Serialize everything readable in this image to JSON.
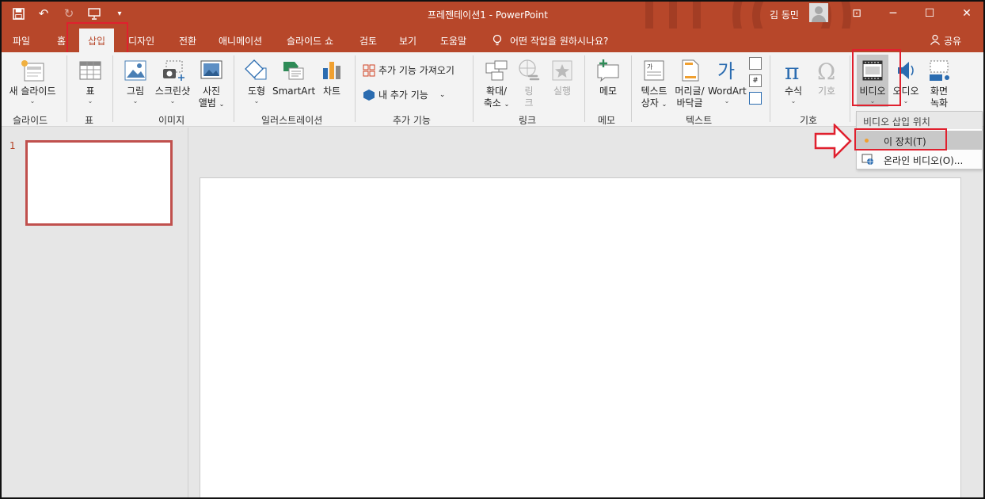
{
  "window": {
    "title": "프레젠테이션1  -  PowerPoint",
    "user": "김 동민",
    "qat": [
      "save-icon",
      "undo-icon",
      "redo-icon",
      "slideshow-icon",
      "customize-icon"
    ]
  },
  "tabs": [
    "파일",
    "홈",
    "삽입",
    "디자인",
    "전환",
    "애니메이션",
    "슬라이드 쇼",
    "검토",
    "보기",
    "도움말"
  ],
  "tell_me": "어떤 작업을 원하시나요?",
  "share": "공유",
  "ribbon": {
    "new_slide": "새 슬라이드",
    "table": "표",
    "picture": "그림",
    "screenshot": "스크린샷",
    "photo_album_1": "사진",
    "photo_album_2": "앨범",
    "shapes": "도형",
    "smartart": "SmartArt",
    "chart": "차트",
    "get_addins": "추가 기능 가져오기",
    "my_addins": "내 추가 기능",
    "zoom_1": "확대/",
    "zoom_2": "축소",
    "link_1": "링",
    "link_2": "크",
    "action": "실행",
    "comment": "메모",
    "textbox_1": "텍스트",
    "textbox_2": "상자",
    "header_footer_1": "머리글/",
    "header_footer_2": "바닥글",
    "wordart": "WordArt",
    "equation": "수식",
    "symbol": "기호",
    "video": "비디오",
    "audio": "오디오",
    "screen_rec_1": "화면",
    "screen_rec_2": "녹화"
  },
  "groups": {
    "slides": "슬라이드",
    "tables": "표",
    "images": "이미지",
    "illustrations": "일러스트레이션",
    "addins": "추가 기능",
    "links": "링크",
    "comments": "메모",
    "text": "텍스트",
    "symbols": "기호"
  },
  "dropdown": {
    "header": "비디오 삽입 위치",
    "item_device": "이 장치(T)",
    "item_online": "온라인 비디오(O)..."
  },
  "slides": {
    "number": "1"
  }
}
